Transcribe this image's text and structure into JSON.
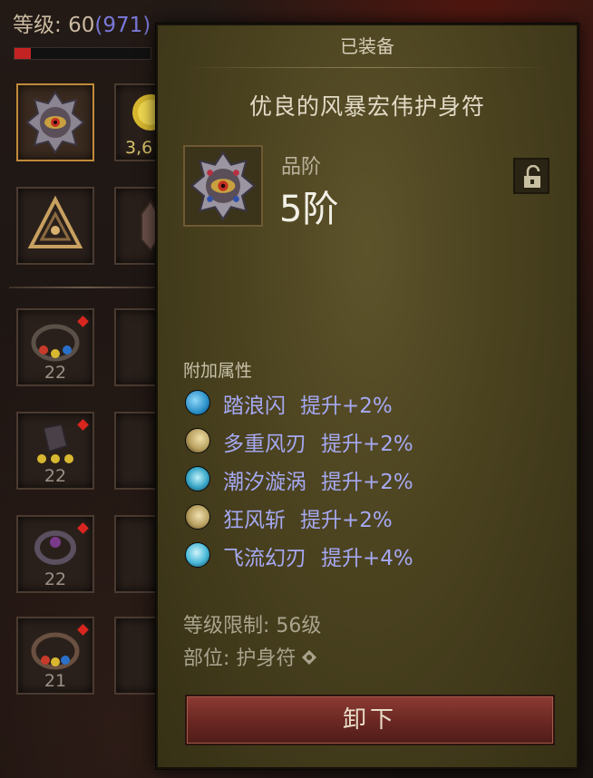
{
  "player": {
    "level_label": "等级: ",
    "level": "60",
    "paragon": "(971)",
    "xp_fraction": 0.12
  },
  "inventory": {
    "gold_count": "3,6",
    "slots": [
      {
        "name": "amulet-slot",
        "level": ""
      },
      {
        "name": "ring-slot-1",
        "level": "22"
      },
      {
        "name": "ring-slot-2",
        "level": "22"
      },
      {
        "name": "ring-slot-3",
        "level": "22"
      },
      {
        "name": "ring-slot-4",
        "level": "21"
      }
    ]
  },
  "tooltip": {
    "header": "已装备",
    "item_name": "优良的风暴宏伟护身符",
    "grade_label": "品阶",
    "grade_value": "5阶",
    "attributes_title": "附加属性",
    "attributes": [
      {
        "skill": "踏浪闪",
        "bonus": "提升+2%",
        "icon": "wave-dash-icon",
        "color": "#2a8fc8"
      },
      {
        "skill": "多重风刃",
        "bonus": "提升+2%",
        "icon": "multi-blade-icon",
        "color": "#b8a060"
      },
      {
        "skill": "潮汐漩涡",
        "bonus": "提升+2%",
        "icon": "tide-vortex-icon",
        "color": "#3aa8c8"
      },
      {
        "skill": "狂风斩",
        "bonus": "提升+2%",
        "icon": "gale-slash-icon",
        "color": "#b8a060"
      },
      {
        "skill": "飞流幻刃",
        "bonus": "提升+4%",
        "icon": "flying-blade-icon",
        "color": "#48b8d8"
      }
    ],
    "level_req": "等级限制: 56级",
    "slot_label": "部位: 护身符",
    "unequip_label": "卸下"
  },
  "colors": {
    "attribute_text": "#a5a8f2",
    "paragon": "#7a78d8",
    "button": "#7a312b"
  }
}
